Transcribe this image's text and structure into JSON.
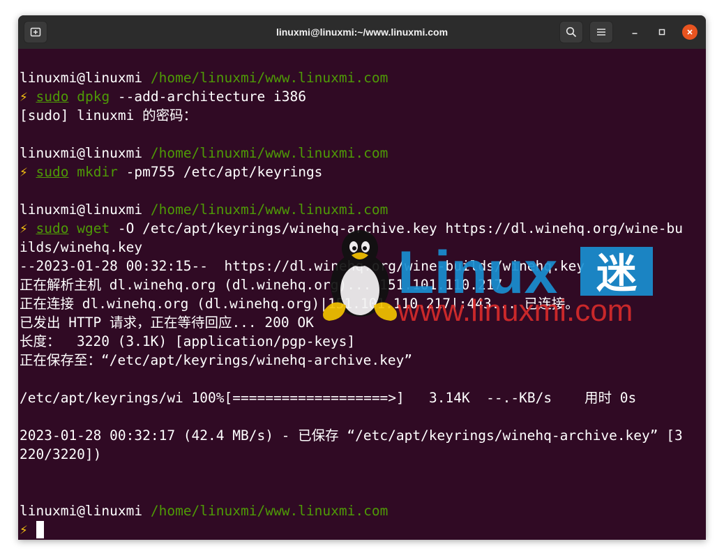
{
  "window": {
    "title": "linuxmi@linuxmi:~/www.linuxmi.com"
  },
  "titlebar": {
    "new_tab_icon": "new-tab-icon",
    "search_icon": "search-icon",
    "menu_icon": "hamburger-menu-icon",
    "minimize_icon": "minimize-icon",
    "maximize_icon": "maximize-icon",
    "close_icon": "close-icon"
  },
  "colors": {
    "terminal_bg": "#300a24",
    "prompt_path": "#4e9a06",
    "bolt": "#f5c211",
    "close_button": "#e95420",
    "watermark_blue": "#1a8fd1",
    "watermark_red": "#d62b2b"
  },
  "terminal": {
    "prompt_user": "linuxmi@linuxmi",
    "prompt_path": "/home/linuxmi/www.linuxmi.com",
    "bolt": "⚡",
    "sudo": "sudo",
    "cmd1_name": "dpkg",
    "cmd1_args": " --add-architecture i386",
    "sudo_prompt": "[sudo] linuxmi 的密码：",
    "cmd2_name": "mkdir",
    "cmd2_args": " -pm755 /etc/apt/keyrings",
    "cmd3_name": "wget",
    "cmd3_args": " -O /etc/apt/keyrings/winehq-archive.key https://dl.winehq.org/wine-bu",
    "cmd3_wrap": "ilds/winehq.key",
    "output": [
      "--2023-01-28 00:32:15--  https://dl.winehq.org/wine-builds/winehq.key",
      "正在解析主机 dl.winehq.org (dl.winehq.org)... 151.101.110.217",
      "正在连接 dl.winehq.org (dl.winehq.org)|151.101.110.217|:443... 已连接。",
      "已发出 HTTP 请求，正在等待回应... 200 OK",
      "长度：  3220 (3.1K) [application/pgp-keys]",
      "正在保存至：“/etc/apt/keyrings/winehq-archive.key”",
      "",
      "/etc/apt/keyrings/wi 100%[===================>]   3.14K  --.-KB/s    用时 0s",
      "",
      "2023-01-28 00:32:17 (42.4 MB/s) - 已保存 “/etc/apt/keyrings/winehq-archive.key” [3",
      "220/3220])"
    ]
  },
  "watermark": {
    "brand": "Linux",
    "brand_cn": "迷",
    "url": "www.linuxmi.com"
  }
}
